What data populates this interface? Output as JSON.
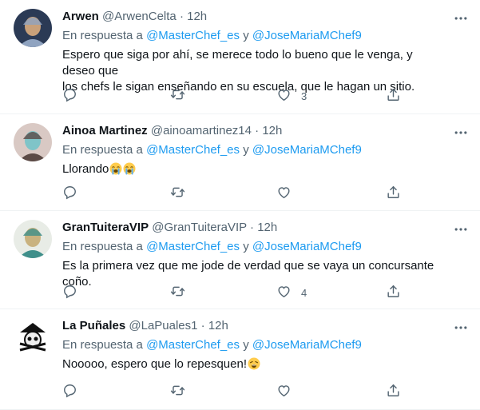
{
  "reply_prefix": "En respuesta a",
  "reply_and": "y",
  "tweets": [
    {
      "name": "Arwen",
      "handle": "@ArwenCelta",
      "time": "12h",
      "mentions": [
        "@MasterChef_es",
        "@JoseMariaMChef9"
      ],
      "lines": [
        "Espero que siga por ahí, se merece todo lo bueno que le venga, y deseo que",
        "los chefs le sigan enseñando en su escuela, que le hagan un sitio."
      ],
      "like_count": "3",
      "avatar_colors": [
        "#2b3a55",
        "#8fa3c0",
        "#c8a07a"
      ]
    },
    {
      "name": "Ainoa Martinez",
      "handle": "@ainoamartinez14",
      "time": "12h",
      "mentions": [
        "@MasterChef_es",
        "@JoseMariaMChef9"
      ],
      "lines": [
        "Llorando"
      ],
      "emoji": [
        "loudly-crying-face",
        "loudly-crying-face"
      ],
      "like_count": "",
      "avatar_colors": [
        "#d9c9c4",
        "#5b4a46",
        "#7fc4c8"
      ]
    },
    {
      "name": "GranTuiteraVIP",
      "handle": "@GranTuiteraVIP",
      "time": "12h",
      "mentions": [
        "@MasterChef_es",
        "@JoseMariaMChef9"
      ],
      "lines": [
        "Es la primera vez que me jode de verdad que se vaya un concursante coño."
      ],
      "like_count": "4",
      "avatar_colors": [
        "#e8ece6",
        "#3f8f8a",
        "#c9b27f"
      ]
    },
    {
      "name": "La Puñales",
      "handle": "@LaPuales1",
      "time": "12h",
      "mentions": [
        "@MasterChef_es",
        "@JoseMariaMChef9"
      ],
      "lines": [
        "Nooooo, espero que lo repesquen!"
      ],
      "emoji": [
        "weary-face"
      ],
      "like_count": "",
      "avatar_colors": [
        "#ffffff",
        "#111111",
        "#dddddd"
      ]
    }
  ]
}
